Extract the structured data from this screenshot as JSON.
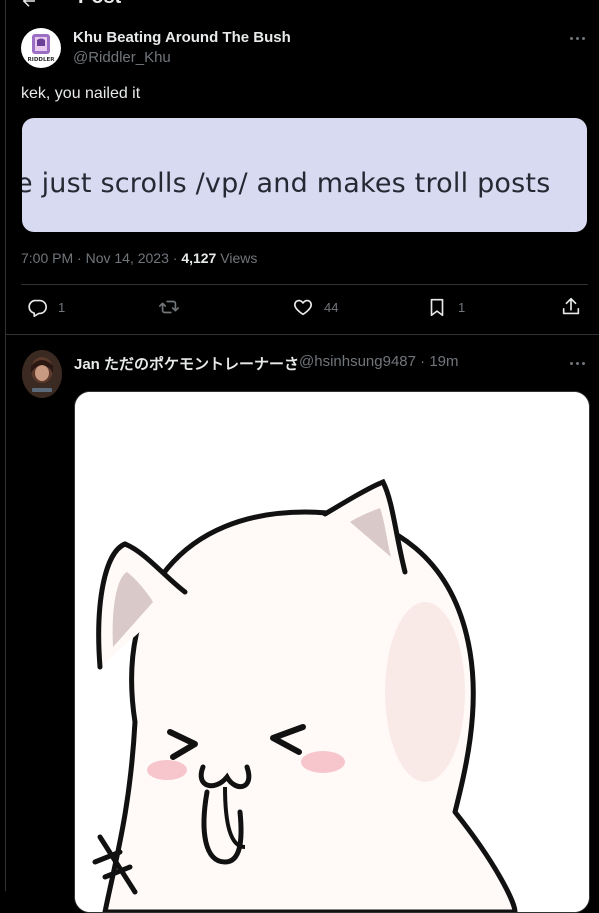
{
  "header": {
    "title": "Post"
  },
  "main_post": {
    "author_name": "Khu Beating Around The Bush",
    "handle": "@Riddler_Khu",
    "avatar_label": "RIDDLER",
    "text": "kek, you nailed it",
    "quote_image_text": "e just scrolls /vp/ and makes troll posts",
    "timestamp": "7:00 PM · Nov 14, 2023 · ",
    "views_count": "4,127",
    "views_label": " Views",
    "actions": {
      "replies": "1",
      "reposts": "",
      "likes": "44",
      "bookmarks": "1"
    }
  },
  "reply_post": {
    "author_name": "Jan ただのポケモントレーナーさ",
    "handle": "@hsinhsung9487",
    "time": " · 19m",
    "image_description_icon": "cute-cat-icon"
  },
  "colors": {
    "background": "#000000",
    "border": "#2f3336",
    "text": "#e7e9ea",
    "muted": "#71767b",
    "quote_bg": "#d7daf0"
  }
}
